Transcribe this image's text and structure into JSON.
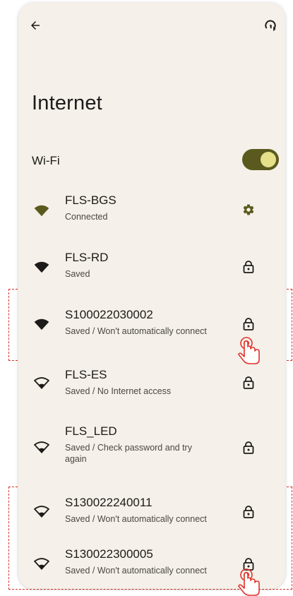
{
  "header": {
    "back_icon": "arrow-back-icon",
    "help_icon": "help-feedback-icon"
  },
  "title": "Internet",
  "wifi": {
    "label": "Wi-Fi",
    "enabled": true
  },
  "networks": [
    {
      "name": "FLS-BGS",
      "status": "Connected",
      "signal": "full",
      "signal_color": "#5a5a1e",
      "trailing_icon": "settings-gear-icon"
    },
    {
      "name": "FLS-RD",
      "status": "Saved",
      "signal": "full",
      "trailing_icon": "lock-icon"
    },
    {
      "name": "S100022030002",
      "status": "Saved / Won't automatically connect",
      "signal": "full",
      "trailing_icon": "lock-icon"
    },
    {
      "name": "FLS-ES",
      "status": "Saved / No Internet access",
      "signal": "outline",
      "trailing_icon": "lock-icon"
    },
    {
      "name": "FLS_LED",
      "status": "Saved / Check password and try again",
      "signal": "outline",
      "trailing_icon": "lock-icon"
    },
    {
      "name": "S130022240011",
      "status": "Saved / Won't automatically connect",
      "signal": "outline",
      "trailing_icon": "lock-icon"
    },
    {
      "name": "S130022300005",
      "status": "Saved / Won't automatically connect",
      "signal": "outline",
      "trailing_icon": "lock-icon"
    }
  ],
  "colors": {
    "background": "#f5f0e9",
    "accent": "#5a5a1e",
    "highlight_dash": "#d9302a",
    "cursor": "#e0332b"
  }
}
